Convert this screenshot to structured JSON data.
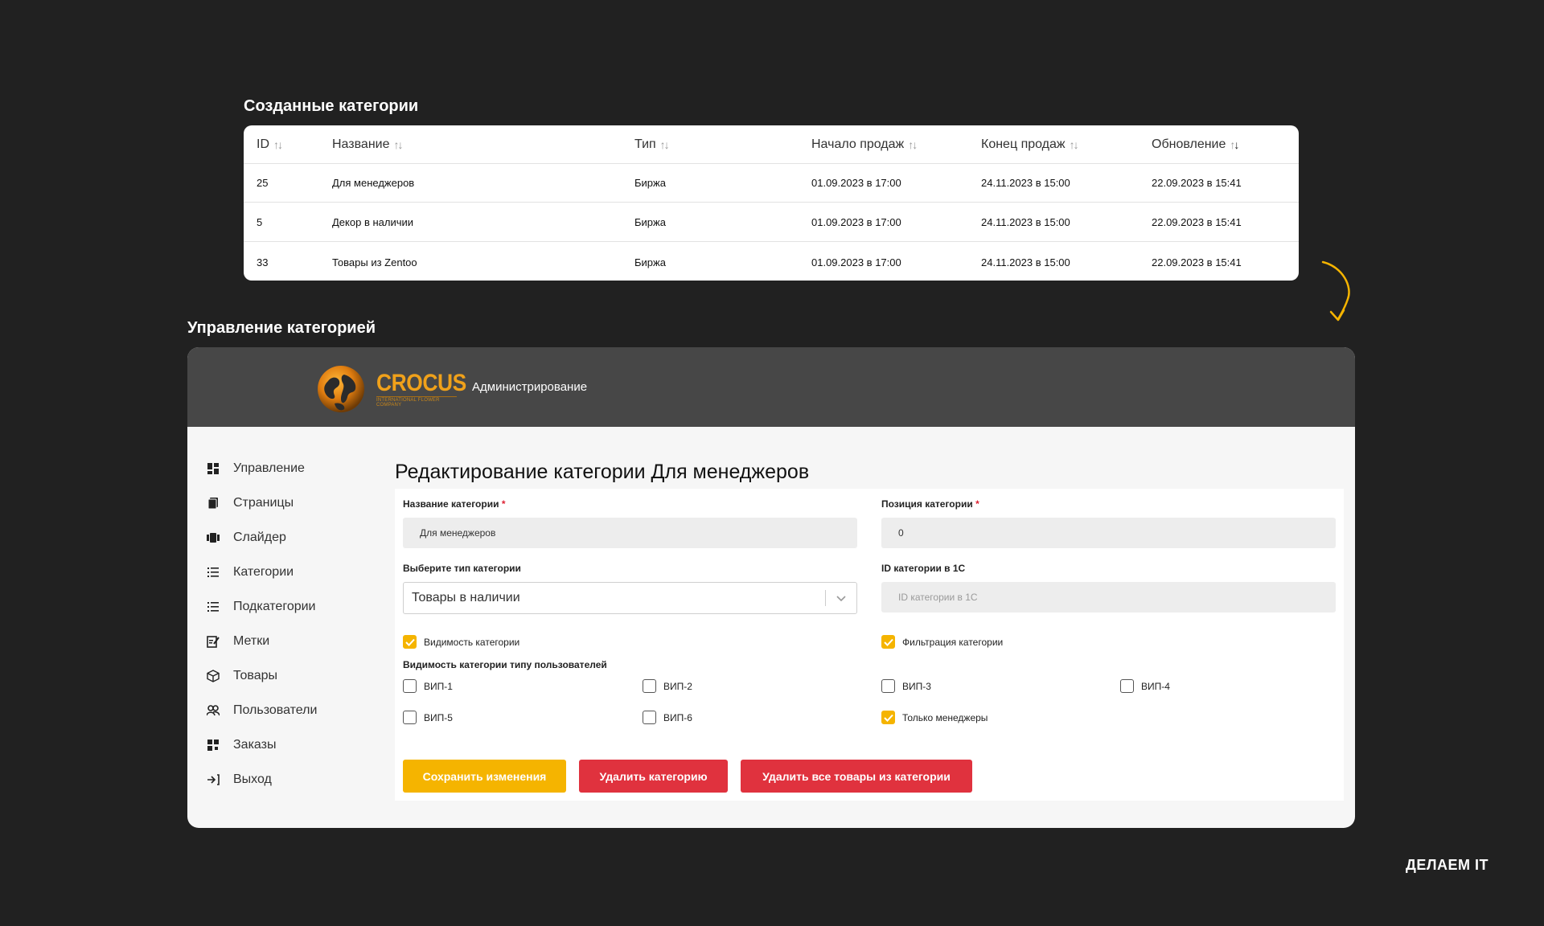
{
  "sections": {
    "created_title": "Созданные категории",
    "manage_title": "Управление категорией"
  },
  "table": {
    "headers": [
      "ID",
      "Название",
      "Тип",
      "Начало продаж",
      "Конец продаж",
      "Обновление"
    ],
    "sort_icon": "↑↓",
    "rows": [
      [
        "25",
        "Для менеджеров",
        "Биржа",
        "01.09.2023 в 17:00",
        "24.11.2023 в 15:00",
        "22.09.2023 в 15:41"
      ],
      [
        "5",
        "Декор в наличии",
        "Биржа",
        "01.09.2023 в 17:00",
        "24.11.2023 в 15:00",
        "22.09.2023 в 15:41"
      ],
      [
        "33",
        "Товары из Zentoo",
        "Биржа",
        "01.09.2023 в 17:00",
        "24.11.2023 в 15:00",
        "22.09.2023 в 15:41"
      ]
    ]
  },
  "header": {
    "logo_text": "CROCUS",
    "logo_sub": "INTERNATIONAL FLOWER COMPANY",
    "admin_label": "Администрирование"
  },
  "sidebar": {
    "items": [
      {
        "label": "Управление",
        "icon": "dashboard-icon"
      },
      {
        "label": "Страницы",
        "icon": "pages-icon"
      },
      {
        "label": "Слайдер",
        "icon": "slider-icon"
      },
      {
        "label": "Категории",
        "icon": "list-icon"
      },
      {
        "label": "Подкатегории",
        "icon": "list-icon"
      },
      {
        "label": "Метки",
        "icon": "edit-note-icon"
      },
      {
        "label": "Товары",
        "icon": "box-icon"
      },
      {
        "label": "Пользователи",
        "icon": "users-icon"
      },
      {
        "label": "Заказы",
        "icon": "orders-icon"
      },
      {
        "label": "Выход",
        "icon": "logout-icon"
      }
    ]
  },
  "form": {
    "title": "Редактирование категории Для менеджеров",
    "name_label": "Название категории",
    "name_value": "Для менеджеров",
    "position_label": "Позиция категории",
    "position_value": "0",
    "type_label": "Выберите тип категории",
    "type_value": "Товары в наличии",
    "id1c_label": "ID категории в 1С",
    "id1c_placeholder": "ID категории в 1С",
    "required_mark": "*",
    "visibility_label": "Видимость категории",
    "visibility_checked": true,
    "filter_label": "Фильтрация категории",
    "filter_checked": true,
    "user_type_label": "Видимость категории типу пользователей",
    "user_types": [
      {
        "label": "ВИП-1",
        "checked": false
      },
      {
        "label": "ВИП-2",
        "checked": false
      },
      {
        "label": "ВИП-3",
        "checked": false
      },
      {
        "label": "ВИП-4",
        "checked": false
      },
      {
        "label": "ВИП-5",
        "checked": false
      },
      {
        "label": "ВИП-6",
        "checked": false
      },
      {
        "label": "Только менеджеры",
        "checked": true
      }
    ],
    "save_button": "Сохранить изменения",
    "delete_button": "Удалить категорию",
    "delete_all_button": "Удалить все товары из категории"
  },
  "brand": "ДЕЛАЕМ IT",
  "colors": {
    "accent": "#f5b400",
    "danger": "#e0323e",
    "background": "#212121"
  }
}
